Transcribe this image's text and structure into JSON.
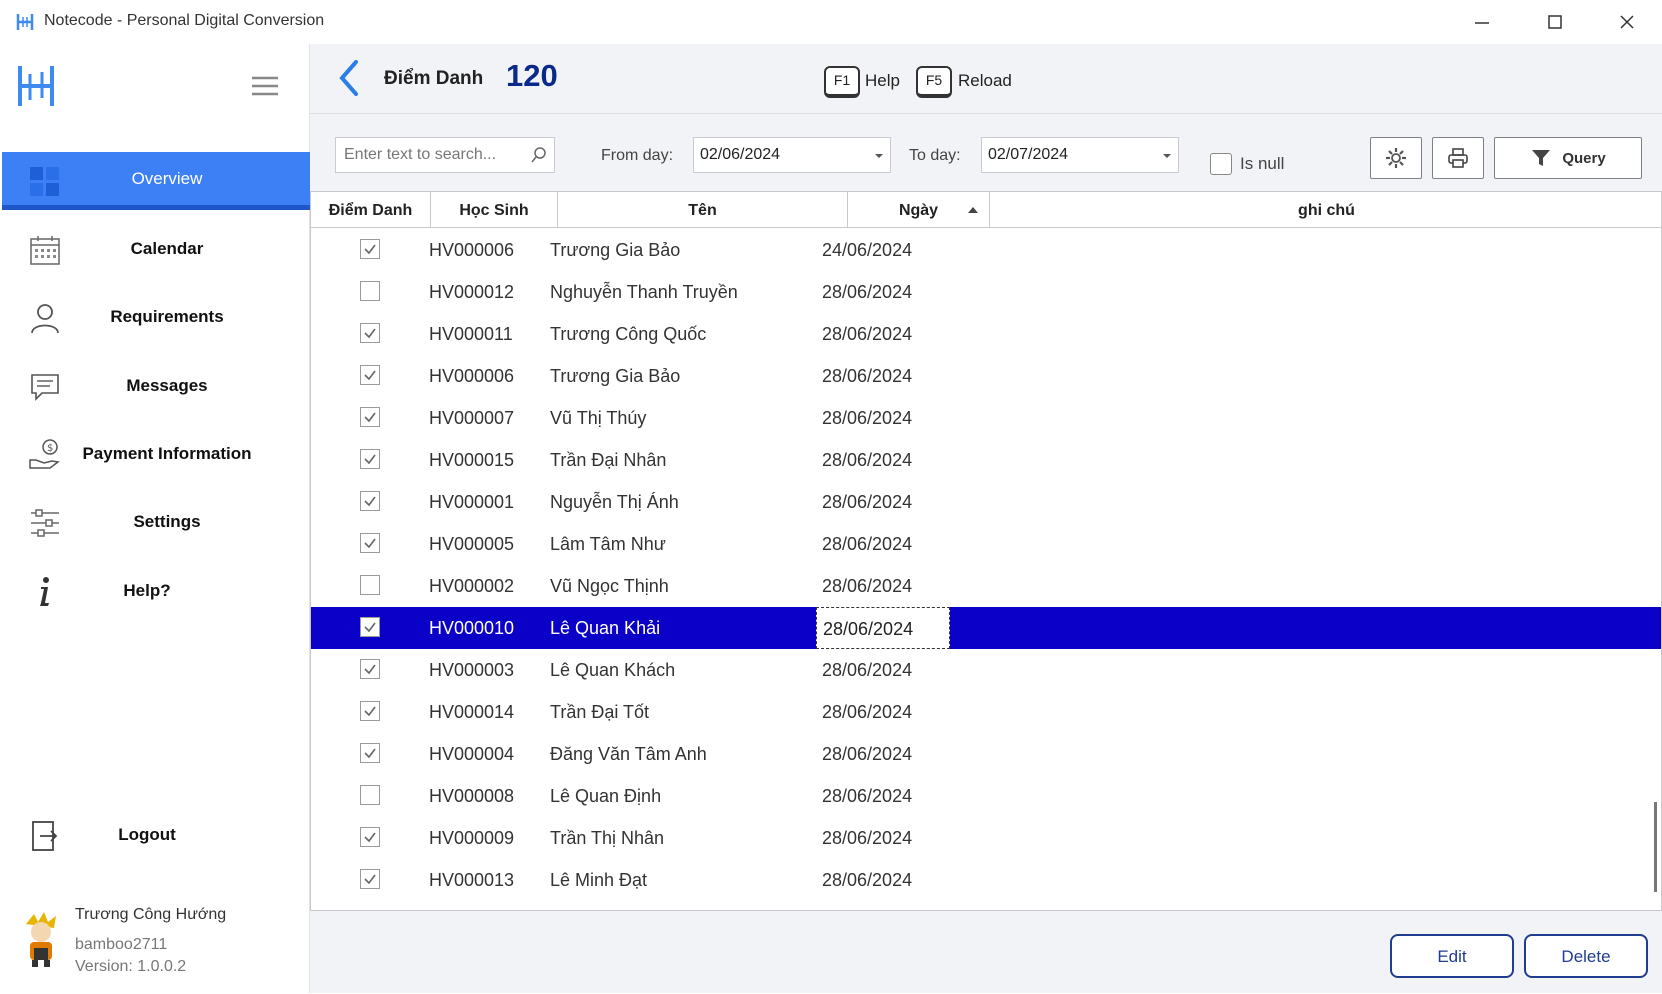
{
  "window": {
    "title": "Notecode - Personal Digital Conversion"
  },
  "sidebar": {
    "items": [
      {
        "label": "Overview",
        "icon": "overview-icon",
        "active": true
      },
      {
        "label": "Calendar",
        "icon": "calendar-icon"
      },
      {
        "label": "Requirements",
        "icon": "user-icon"
      },
      {
        "label": "Messages",
        "icon": "message-icon"
      },
      {
        "label": "Payment Information",
        "icon": "payment-icon"
      },
      {
        "label": "Settings",
        "icon": "sliders-icon"
      },
      {
        "label": "Help?",
        "icon": "info-icon"
      }
    ],
    "logout_label": "Logout",
    "user": {
      "name": "Trương Công Hướng",
      "username": "bamboo2711",
      "version": "Version: 1.0.0.2"
    }
  },
  "header": {
    "title": "Điểm Danh",
    "count": "120",
    "help_key": "F1",
    "help_label": "Help",
    "reload_key": "F5",
    "reload_label": "Reload"
  },
  "filters": {
    "search_placeholder": "Enter text to search...",
    "from_label": "From day:",
    "from_value": "02/06/2024",
    "to_label": "To day:",
    "to_value": "02/07/2024",
    "isnull_label": "Is null",
    "query_label": "Query"
  },
  "table": {
    "columns": [
      "Điểm Danh",
      "Học Sinh",
      "Tên",
      "Ngày",
      "ghi chú"
    ],
    "rows": [
      {
        "checked": true,
        "id": "HV000006",
        "name": "Trương Gia Bảo",
        "date": "24/06/2024"
      },
      {
        "checked": false,
        "id": "HV000012",
        "name": "Nghuyễn Thanh Truyền",
        "date": "28/06/2024"
      },
      {
        "checked": true,
        "id": "HV000011",
        "name": "Trương Công Quốc",
        "date": "28/06/2024"
      },
      {
        "checked": true,
        "id": "HV000006",
        "name": "Trương Gia Bảo",
        "date": "28/06/2024"
      },
      {
        "checked": true,
        "id": "HV000007",
        "name": "Vũ Thị Thúy",
        "date": "28/06/2024"
      },
      {
        "checked": true,
        "id": "HV000015",
        "name": "Trần Đại Nhân",
        "date": "28/06/2024"
      },
      {
        "checked": true,
        "id": "HV000001",
        "name": "Nguyễn Thị Ánh",
        "date": "28/06/2024"
      },
      {
        "checked": true,
        "id": "HV000005",
        "name": "Lâm Tâm Như",
        "date": "28/06/2024"
      },
      {
        "checked": false,
        "id": "HV000002",
        "name": "Vũ Ngọc Thịnh",
        "date": "28/06/2024"
      },
      {
        "checked": true,
        "id": "HV000010",
        "name": "Lê Quan Khải",
        "date": "28/06/2024",
        "selected": true
      },
      {
        "checked": true,
        "id": "HV000003",
        "name": "Lê Quan Khách",
        "date": "28/06/2024"
      },
      {
        "checked": true,
        "id": "HV000014",
        "name": "Trần Đại Tốt",
        "date": "28/06/2024"
      },
      {
        "checked": true,
        "id": "HV000004",
        "name": "Đăng Văn Tâm Anh",
        "date": "28/06/2024"
      },
      {
        "checked": false,
        "id": "HV000008",
        "name": "Lê Quan Định",
        "date": "28/06/2024"
      },
      {
        "checked": true,
        "id": "HV000009",
        "name": "Trần Thị Nhân",
        "date": "28/06/2024"
      },
      {
        "checked": true,
        "id": "HV000013",
        "name": "Lê Minh Đạt",
        "date": "28/06/2024"
      }
    ]
  },
  "actions": {
    "edit_label": "Edit",
    "delete_label": "Delete"
  },
  "colors": {
    "accent": "#3d7ff5",
    "selected_row": "#0a00c8",
    "button_border": "#1f3c8f"
  }
}
